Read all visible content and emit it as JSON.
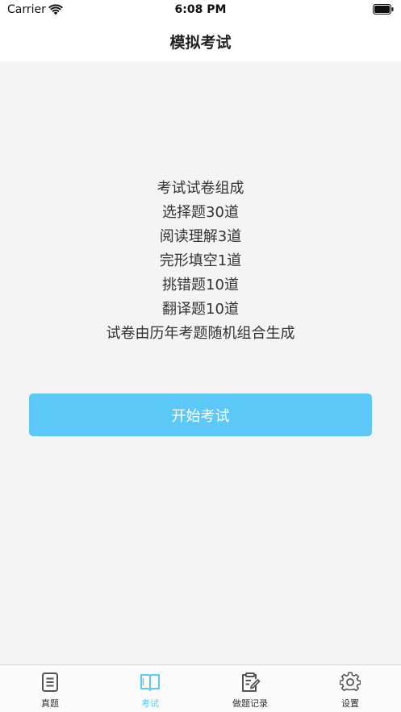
{
  "status_bar": {
    "carrier": "Carrier",
    "time": "6:08 PM"
  },
  "nav": {
    "title": "模拟考试"
  },
  "exam_info": {
    "lines": [
      "考试试卷组成",
      "选择题30道",
      "阅读理解3道",
      "完形填空1道",
      "挑错题10道",
      "翻译题10道",
      "试卷由历年考题随机组合生成"
    ]
  },
  "start_button": {
    "label": "开始考试"
  },
  "tabs": [
    {
      "label": "真题",
      "icon": "document-icon",
      "active": false
    },
    {
      "label": "考试",
      "icon": "book-icon",
      "active": true
    },
    {
      "label": "做题记录",
      "icon": "clipboard-edit-icon",
      "active": false
    },
    {
      "label": "设置",
      "icon": "gear-icon",
      "active": false
    }
  ],
  "colors": {
    "accent": "#5bc8f7",
    "background": "#f4f4f4",
    "inactive_icon": "#555555"
  }
}
